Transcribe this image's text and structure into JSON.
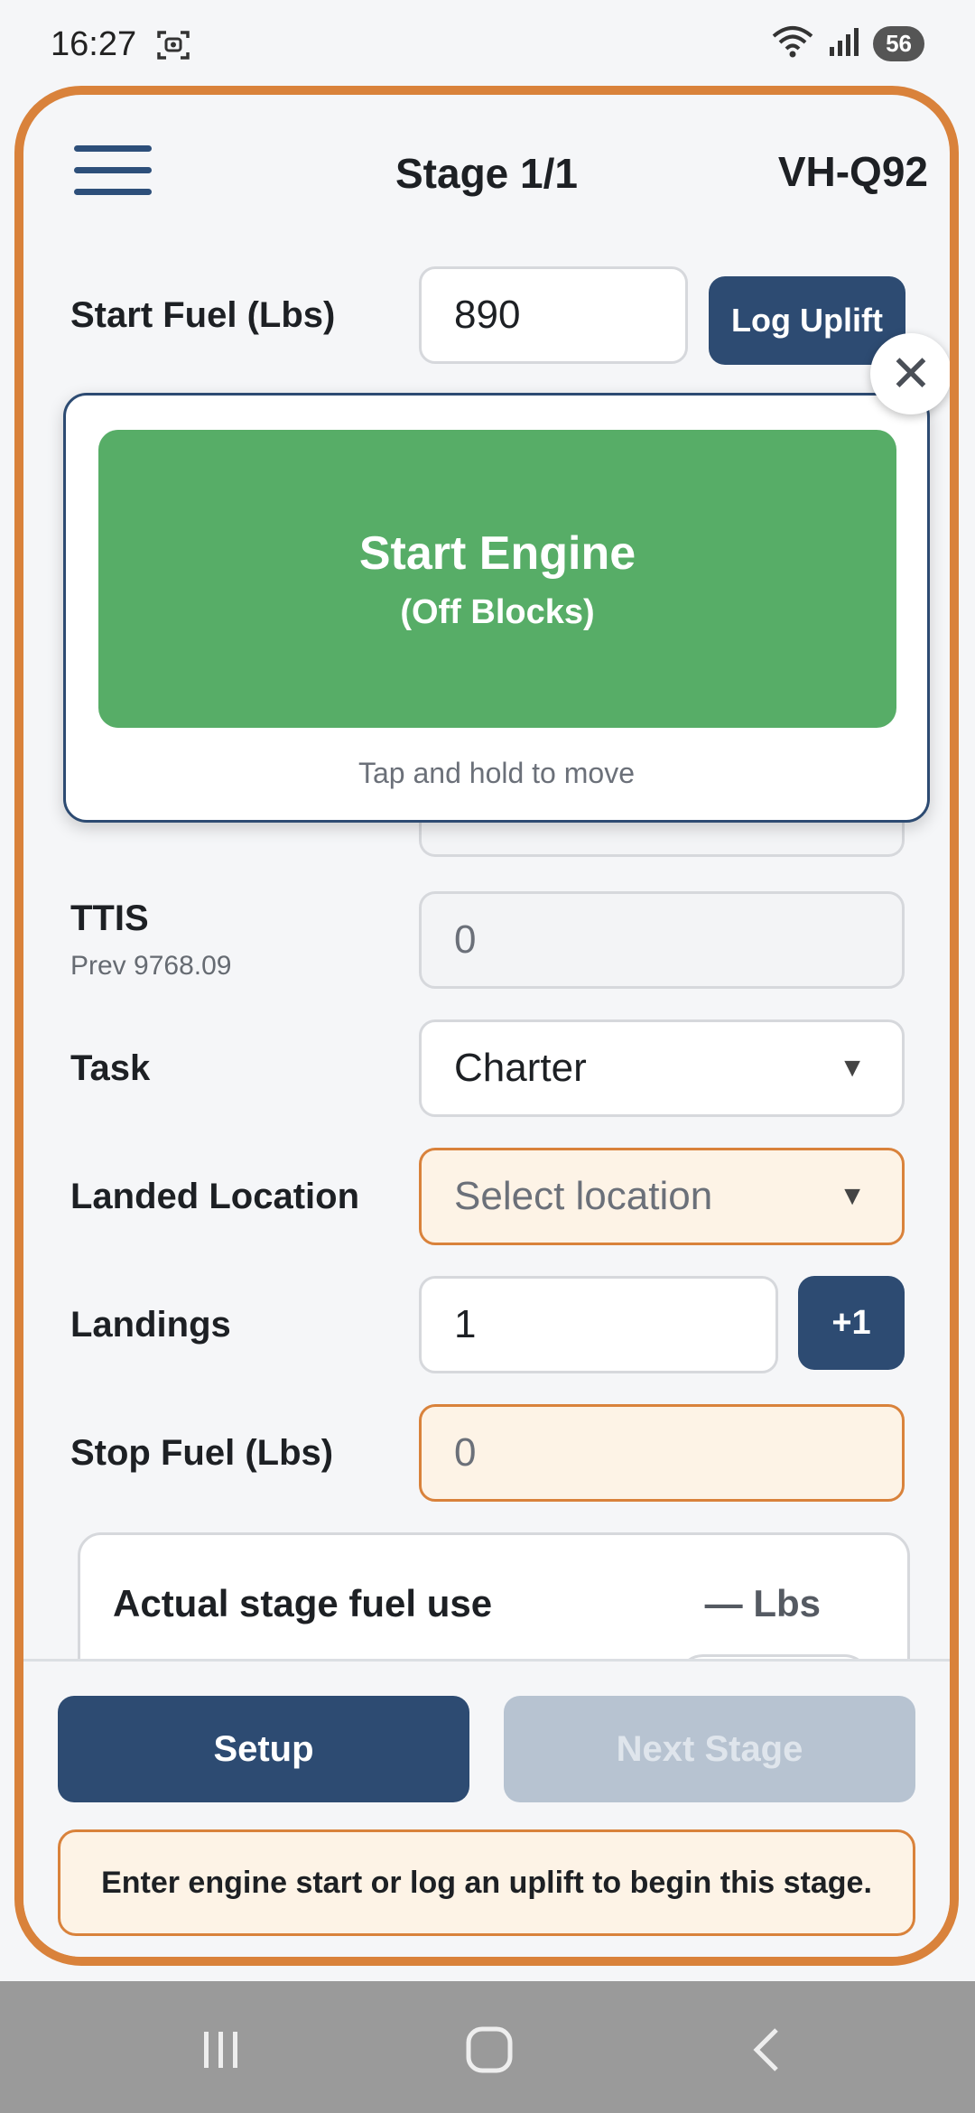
{
  "status_bar": {
    "time": "16:27",
    "battery": "56",
    "icons": [
      "screen-capture-icon",
      "wifi-icon",
      "signal-icon",
      "battery-icon"
    ]
  },
  "header": {
    "title": "Stage 1/1",
    "registration": "VH-Q92"
  },
  "form": {
    "start_fuel": {
      "label": "Start Fuel (Lbs)",
      "value": "890"
    },
    "log_uplift_label": "Log Uplift",
    "ttis": {
      "label": "TTIS",
      "sub": "Prev 9768.09",
      "value": "0"
    },
    "task": {
      "label": "Task",
      "value": "Charter"
    },
    "landed_location": {
      "label": "Landed Location",
      "placeholder": "Select location"
    },
    "landings": {
      "label": "Landings",
      "value": "1",
      "increment_label": "+1"
    },
    "stop_fuel": {
      "label": "Stop Fuel (Lbs)",
      "value": "0"
    }
  },
  "popup": {
    "button_title": "Start Engine",
    "button_subtitle": "(Off Blocks)",
    "hint": "Tap and hold to move"
  },
  "fuel_card": {
    "label": "Actual stage fuel use",
    "value": "— Lbs"
  },
  "actions": {
    "setup_label": "Setup",
    "next_label": "Next Stage",
    "notice": "Enter engine start or log an uplift to begin this stage."
  },
  "colors": {
    "accent": "#d9823b",
    "primary": "#2d4b72",
    "start_engine": "#57ad67",
    "disabled": "#b7c3d1"
  }
}
